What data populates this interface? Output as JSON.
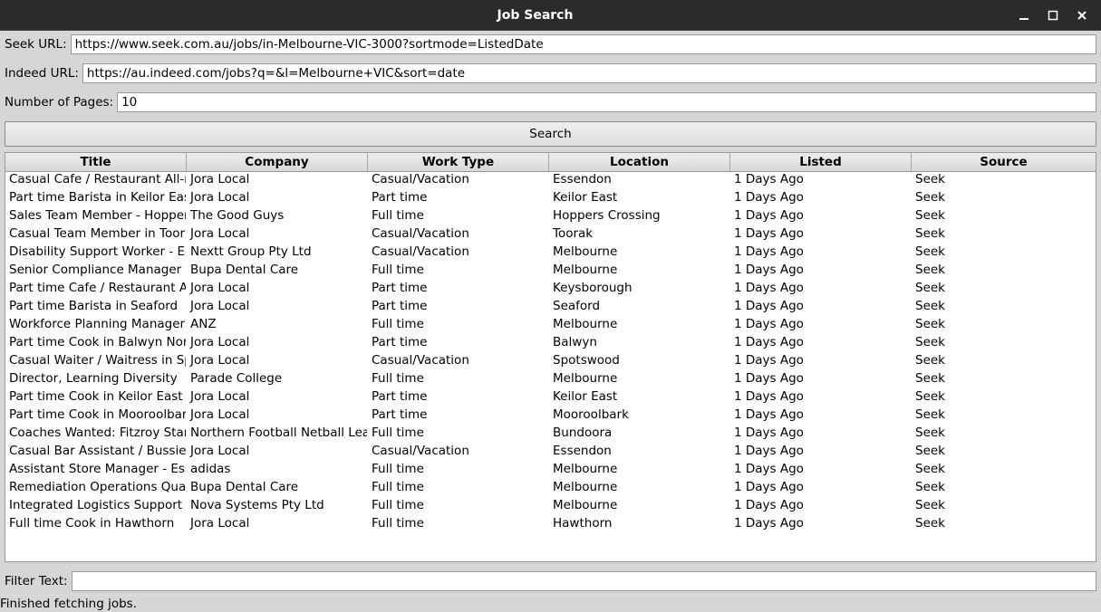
{
  "window": {
    "title": "Job Search"
  },
  "form": {
    "seek_label": "Seek URL:",
    "seek_value": "https://www.seek.com.au/jobs/in-Melbourne-VIC-3000?sortmode=ListedDate",
    "indeed_label": "Indeed URL:",
    "indeed_value": "https://au.indeed.com/jobs?q=&l=Melbourne+VIC&sort=date",
    "pages_label": "Number of Pages:",
    "pages_value": "10",
    "search_label": "Search"
  },
  "table": {
    "headers": {
      "title": "Title",
      "company": "Company",
      "worktype": "Work Type",
      "location": "Location",
      "listed": "Listed",
      "source": "Source"
    },
    "rows": [
      {
        "title": "Casual Cafe / Restaurant All-r",
        "company": "Jora Local",
        "worktype": "Casual/Vacation",
        "location": "Essendon",
        "listed": "1 Days Ago",
        "source": "Seek"
      },
      {
        "title": "Part time Barista in Keilor Eas",
        "company": "Jora Local",
        "worktype": "Part time",
        "location": "Keilor East",
        "listed": "1 Days Ago",
        "source": "Seek"
      },
      {
        "title": "Sales Team Member - Hoppers",
        "company": "The Good Guys",
        "worktype": "Full time",
        "location": "Hoppers Crossing",
        "listed": "1 Days Ago",
        "source": "Seek"
      },
      {
        "title": "Casual Team Member in Toor",
        "company": "Jora Local",
        "worktype": "Casual/Vacation",
        "location": "Toorak",
        "listed": "1 Days Ago",
        "source": "Seek"
      },
      {
        "title": "Disability Support Worker - Ea",
        "company": "Nextt Group Pty Ltd",
        "worktype": "Casual/Vacation",
        "location": "Melbourne",
        "listed": "1 Days Ago",
        "source": "Seek"
      },
      {
        "title": "Senior Compliance Manager",
        "company": "Bupa Dental Care",
        "worktype": "Full time",
        "location": "Melbourne",
        "listed": "1 Days Ago",
        "source": "Seek"
      },
      {
        "title": "Part time Cafe / Restaurant Al",
        "company": "Jora Local",
        "worktype": "Part time",
        "location": "Keysborough",
        "listed": "1 Days Ago",
        "source": "Seek"
      },
      {
        "title": "Part time Barista in Seaford",
        "company": "Jora Local",
        "worktype": "Part time",
        "location": "Seaford",
        "listed": "1 Days Ago",
        "source": "Seek"
      },
      {
        "title": "Workforce Planning Manager",
        "company": "ANZ",
        "worktype": "Full time",
        "location": "Melbourne",
        "listed": "1 Days Ago",
        "source": "Seek"
      },
      {
        "title": "Part time Cook in Balwyn Nor",
        "company": "Jora Local",
        "worktype": "Part time",
        "location": "Balwyn",
        "listed": "1 Days Ago",
        "source": "Seek"
      },
      {
        "title": "Casual Waiter / Waitress in Sp",
        "company": "Jora Local",
        "worktype": "Casual/Vacation",
        "location": "Spotswood",
        "listed": "1 Days Ago",
        "source": "Seek"
      },
      {
        "title": "Director, Learning Diversity",
        "company": "Parade College",
        "worktype": "Full time",
        "location": "Melbourne",
        "listed": "1 Days Ago",
        "source": "Seek"
      },
      {
        "title": "Part time Cook in Keilor East",
        "company": "Jora Local",
        "worktype": "Part time",
        "location": "Keilor East",
        "listed": "1 Days Ago",
        "source": "Seek"
      },
      {
        "title": "Part time Cook in Mooroolbar",
        "company": "Jora Local",
        "worktype": "Part time",
        "location": "Mooroolbark",
        "listed": "1 Days Ago",
        "source": "Seek"
      },
      {
        "title": "Coaches Wanted: Fitzroy Star",
        "company": "Northern Football Netball Lea",
        "worktype": "Full time",
        "location": "Bundoora",
        "listed": "1 Days Ago",
        "source": "Seek"
      },
      {
        "title": "Casual Bar Assistant / Bussie",
        "company": "Jora Local",
        "worktype": "Casual/Vacation",
        "location": "Essendon",
        "listed": "1 Days Ago",
        "source": "Seek"
      },
      {
        "title": "Assistant Store Manager - Ess",
        "company": "adidas",
        "worktype": "Full time",
        "location": "Melbourne",
        "listed": "1 Days Ago",
        "source": "Seek"
      },
      {
        "title": "Remediation Operations Qual",
        "company": "Bupa Dental Care",
        "worktype": "Full time",
        "location": "Melbourne",
        "listed": "1 Days Ago",
        "source": "Seek"
      },
      {
        "title": "Integrated Logistics Support C",
        "company": "Nova Systems Pty Ltd",
        "worktype": "Full time",
        "location": "Melbourne",
        "listed": "1 Days Ago",
        "source": "Seek"
      },
      {
        "title": "Full time Cook in Hawthorn",
        "company": "Jora Local",
        "worktype": "Full time",
        "location": "Hawthorn",
        "listed": "1 Days Ago",
        "source": "Seek"
      }
    ]
  },
  "filter": {
    "label": "Filter Text:",
    "value": ""
  },
  "status": "Finished fetching jobs."
}
